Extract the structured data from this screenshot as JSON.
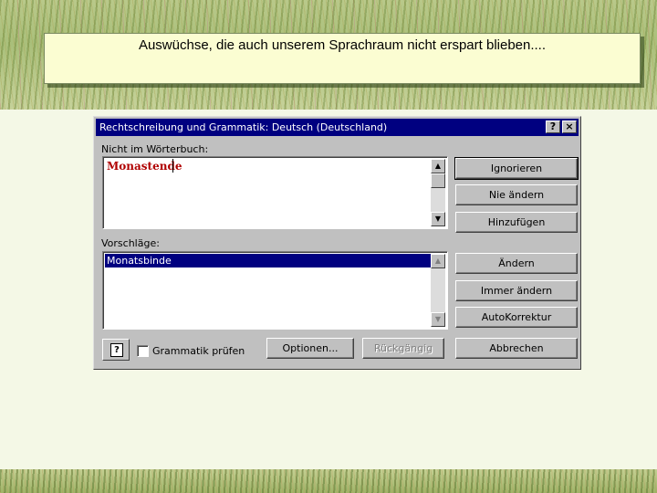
{
  "slide": {
    "caption": "Auswüchse, die auch unserem Sprachraum nicht erspart blieben...."
  },
  "dialog": {
    "title": "Rechtschreibung und Grammatik: Deutsch (Deutschland)",
    "help_glyph": "?",
    "close_glyph": "×",
    "not_in_dictionary_label": "Nicht im Wörterbuch:",
    "misspelled_word": "Monastende",
    "suggestions_label": "Vorschläge:",
    "suggestions": [
      "Monatsbinde"
    ],
    "grammar_check": {
      "label": "Grammatik prüfen",
      "checked": false
    },
    "buttons": {
      "ignore": "Ignorieren",
      "never_change": "Nie ändern",
      "add": "Hinzufügen",
      "change": "Ändern",
      "change_all": "Immer ändern",
      "autocorrect": "AutoKorrektur",
      "options": "Optionen...",
      "undo": "Rückgängig",
      "cancel": "Abbrechen"
    },
    "scroll_up_glyph": "▲",
    "scroll_down_glyph": "▼",
    "office_assistant_glyph": "?"
  }
}
